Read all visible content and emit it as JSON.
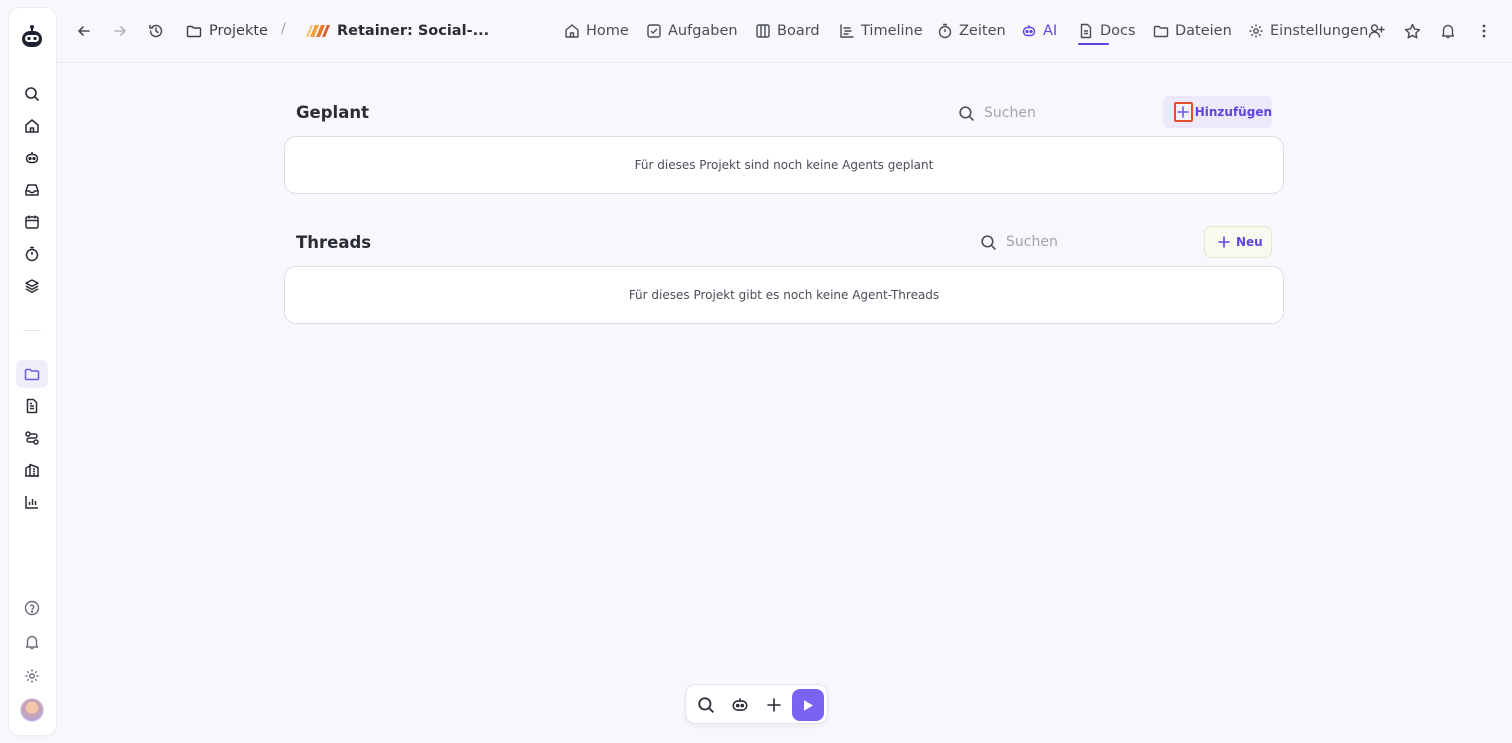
{
  "breadcrumb": {
    "projects_label": "Projekte",
    "separator": "/",
    "project_title": "Retainer: Social-..."
  },
  "nav": {
    "items": [
      {
        "label": "Home",
        "icon": "home-icon"
      },
      {
        "label": "Aufgaben",
        "icon": "checkbox-icon"
      },
      {
        "label": "Board",
        "icon": "columns-icon"
      },
      {
        "label": "Timeline",
        "icon": "timeline-icon"
      },
      {
        "label": "Zeiten",
        "icon": "stopwatch-icon"
      },
      {
        "label": "AI",
        "icon": "robot-icon",
        "active": true
      },
      {
        "label": "Docs",
        "icon": "document-icon"
      },
      {
        "label": "Dateien",
        "icon": "folder-icon"
      },
      {
        "label": "Einstellungen",
        "icon": "gear-icon"
      }
    ]
  },
  "sections": {
    "planned": {
      "title": "Geplant",
      "search_placeholder": "Suchen",
      "add_label": "Hinzufügen",
      "empty_text": "Für dieses Projekt sind noch keine Agents geplant"
    },
    "threads": {
      "title": "Threads",
      "search_placeholder": "Suchen",
      "new_label": "Neu",
      "empty_text": "Für dieses Projekt gibt es noch keine Agent-Threads"
    }
  },
  "colors": {
    "accent": "#5b47e0",
    "play_button": "#7a63f2",
    "add_highlight_border": "#e2502b",
    "background": "#f8f8fc"
  },
  "rail_icons": [
    "robot-logo-icon",
    "search-icon",
    "home-icon",
    "robot-icon",
    "inbox-icon",
    "calendar-icon",
    "stopwatch-icon",
    "layers-icon",
    "folder-icon",
    "document-icon",
    "workflow-icon",
    "building-icon",
    "bar-chart-icon",
    "help-icon",
    "bell-icon",
    "gear-icon",
    "avatar"
  ],
  "dock_icons": [
    "search-icon",
    "robot-icon",
    "plus-icon",
    "play-icon"
  ]
}
